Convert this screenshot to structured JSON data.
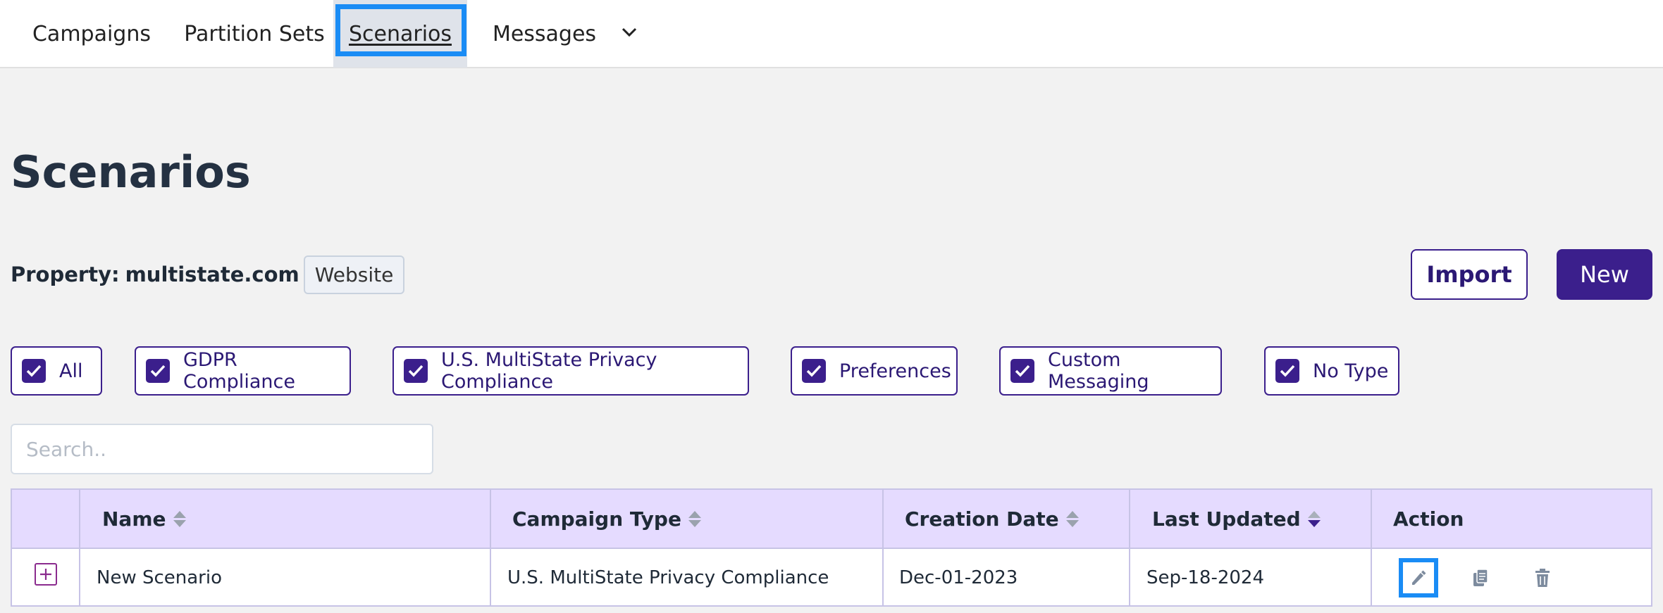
{
  "nav": {
    "tabs": [
      {
        "label": "Campaigns"
      },
      {
        "label": "Partition Sets"
      },
      {
        "label": "Scenarios",
        "active": true
      },
      {
        "label": "Messages"
      }
    ],
    "more_icon": "chevron-down-icon"
  },
  "page": {
    "title": "Scenarios"
  },
  "property": {
    "label": "Property:",
    "value": "multistate.com",
    "badge": "Website"
  },
  "buttons": {
    "import": "Import",
    "new": "New"
  },
  "filters": [
    {
      "label": "All",
      "checked": true
    },
    {
      "label": "GDPR Compliance",
      "checked": true
    },
    {
      "label": "U.S. MultiState Privacy Compliance",
      "checked": true
    },
    {
      "label": "Preferences",
      "checked": true
    },
    {
      "label": "Custom Messaging",
      "checked": true
    },
    {
      "label": "No Type",
      "checked": true
    }
  ],
  "search": {
    "placeholder": "Search..",
    "value": ""
  },
  "table": {
    "columns": [
      "Name",
      "Campaign Type",
      "Creation Date",
      "Last Updated",
      "Action"
    ],
    "sort_active_column": "Last Updated",
    "sort_direction": "descending",
    "rows": [
      {
        "name": "New Scenario",
        "campaign_type": "U.S. MultiState Privacy Compliance",
        "creation_date": "Dec-01-2023",
        "last_updated": "Sep-18-2024",
        "actions": [
          "pencil-icon",
          "copy-icon",
          "trash-icon"
        ]
      }
    ]
  },
  "colors": {
    "accent": "#3b1f8c",
    "highlight": "#1a8cf5",
    "header_bg": "#e5dbff"
  }
}
